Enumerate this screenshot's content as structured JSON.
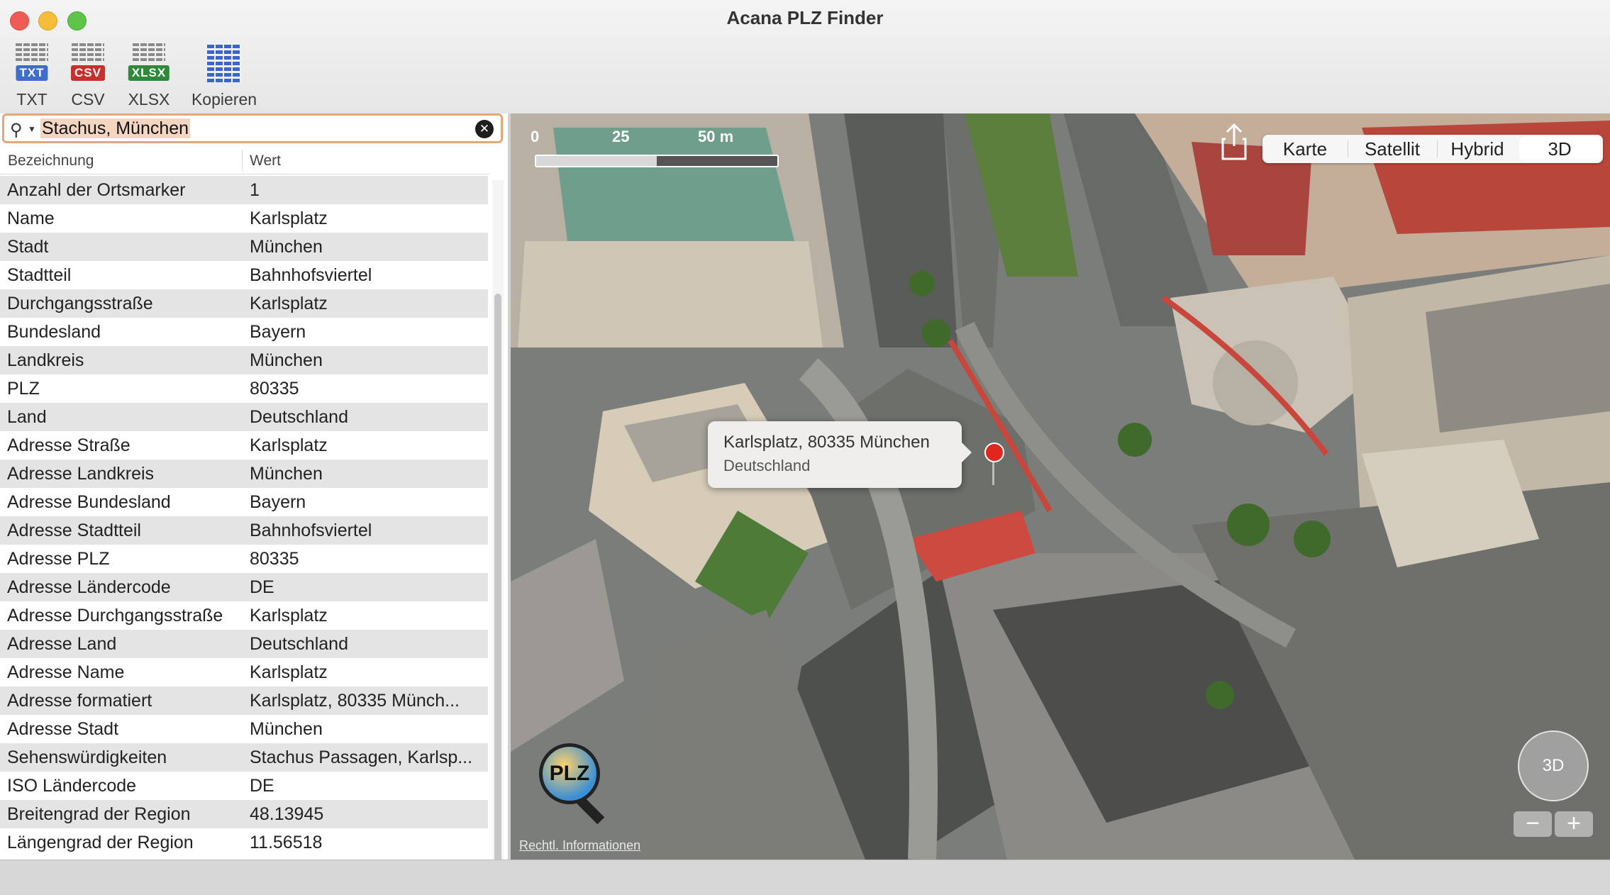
{
  "window": {
    "title": "Acana PLZ Finder"
  },
  "toolbar": {
    "txt_label": "TXT",
    "txt_badge": "TXT",
    "csv_label": "CSV",
    "csv_badge": "CSV",
    "xlsx_label": "XLSX",
    "xlsx_badge": "XLSX",
    "copy_label": "Kopieren"
  },
  "search": {
    "value": "Stachus, München"
  },
  "table": {
    "col_key": "Bezeichnung",
    "col_value": "Wert",
    "rows": [
      {
        "k": "Anzahl der Ortsmarker",
        "v": "1"
      },
      {
        "k": "Name",
        "v": "Karlsplatz"
      },
      {
        "k": "Stadt",
        "v": "München"
      },
      {
        "k": "Stadtteil",
        "v": "Bahnhofsviertel"
      },
      {
        "k": "Durchgangsstraße",
        "v": "Karlsplatz"
      },
      {
        "k": "Bundesland",
        "v": "Bayern"
      },
      {
        "k": "Landkreis",
        "v": "München"
      },
      {
        "k": "PLZ",
        "v": "80335"
      },
      {
        "k": "Land",
        "v": "Deutschland"
      },
      {
        "k": "Adresse Straße",
        "v": "Karlsplatz"
      },
      {
        "k": "Adresse Landkreis",
        "v": "München"
      },
      {
        "k": "Adresse Bundesland",
        "v": "Bayern"
      },
      {
        "k": "Adresse Stadtteil",
        "v": "Bahnhofsviertel"
      },
      {
        "k": "Adresse PLZ",
        "v": "80335"
      },
      {
        "k": "Adresse Ländercode",
        "v": "DE"
      },
      {
        "k": "Adresse Durchgangsstraße",
        "v": "Karlsplatz"
      },
      {
        "k": "Adresse Land",
        "v": "Deutschland"
      },
      {
        "k": "Adresse Name",
        "v": "Karlsplatz"
      },
      {
        "k": "Adresse formatiert",
        "v": "Karlsplatz, 80335 Münch..."
      },
      {
        "k": "Adresse Stadt",
        "v": "München"
      },
      {
        "k": "Sehenswürdigkeiten",
        "v": "Stachus Passagen, Karlsp..."
      },
      {
        "k": "ISO Ländercode",
        "v": "DE"
      },
      {
        "k": "Breitengrad der Region",
        "v": "48.13945"
      },
      {
        "k": "Längengrad der Region",
        "v": "11.56518"
      }
    ]
  },
  "map": {
    "scale_0": "0",
    "scale_25": "25",
    "scale_50": "50 m",
    "modes": [
      "Karte",
      "Satellit",
      "Hybrid",
      "3D"
    ],
    "selected_mode": "3D",
    "callout_line1": "Karlsplatz, 80335 München",
    "callout_line2": "Deutschland",
    "plz_logo": "PLZ",
    "legal": "Rechtl. Informationen",
    "compass_label": "3D",
    "zoom_out": "−",
    "zoom_in": "+"
  },
  "colors": {
    "search_focus": "#e8a677",
    "pin": "#e0261d"
  }
}
